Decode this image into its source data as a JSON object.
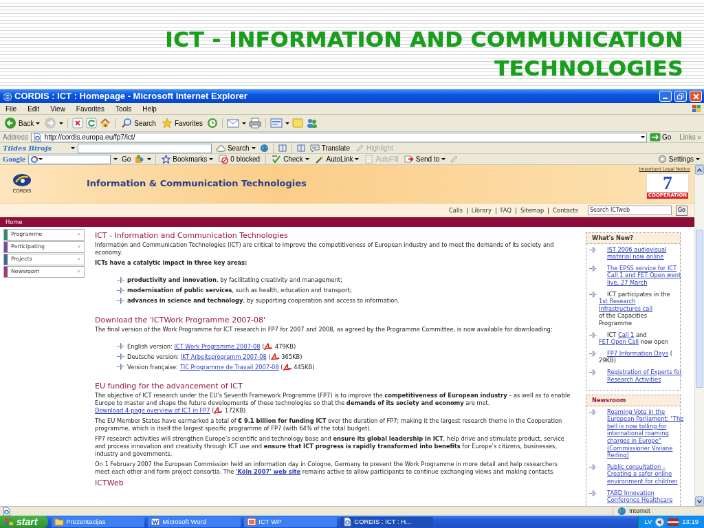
{
  "slide": {
    "title": "ICT - INFORMATION AND COMMUNICATION TECHNOLOGIES"
  },
  "window": {
    "title": "CORDIS : ICT : Homepage - Microsoft Internet Explorer"
  },
  "menu": [
    "File",
    "Edit",
    "View",
    "Favorites",
    "Tools",
    "Help"
  ],
  "toolbar": {
    "back": "Back",
    "search": "Search",
    "favorites": "Favorites"
  },
  "address": {
    "label": "Address",
    "url": "http://cordis.europa.eu/fp7/ict/",
    "go": "Go",
    "links": "Links »"
  },
  "tildes": {
    "logo": "Tildes Birojs",
    "search": "Search",
    "translate": "Translate",
    "highlight": {
      "label": "Highlight",
      "disabled": true
    }
  },
  "google": {
    "logo": "Google",
    "go": "Go",
    "bookmarks": "Bookmarks",
    "blocked": "0 blocked",
    "check": "Check",
    "autolink": "AutoLink",
    "autofill": {
      "label": "AutoFill",
      "disabled": true
    },
    "send_to": "Send to",
    "settings": "Settings"
  },
  "site": {
    "logo_text": "CORDIS",
    "title": "Information & Communication Technologies",
    "legal": "Important Legal Notice",
    "badge_number": "7",
    "badge_text": "COOPERATION",
    "nav": [
      "Calls",
      "Library",
      "FAQ",
      "Sitemap",
      "Contacts"
    ],
    "search_value": "Search ICTweb",
    "search_button": "Go",
    "breadcrumb": "Home"
  },
  "left_nav": [
    {
      "label": "Programme",
      "arrow": "»",
      "color": "#2e8b6e"
    },
    {
      "label": "Participating",
      "arrow": "»",
      "color": "#7a4c9c"
    },
    {
      "label": "Projects",
      "arrow": "»",
      "color": "#3a6a9c"
    },
    {
      "label": "Newsroom",
      "arrow": "»",
      "color": "#9c3a7a"
    }
  ],
  "main": [
    {
      "kind": "heading",
      "text": "ICT - Information and Communication Technologies"
    },
    {
      "kind": "paragraph",
      "parts": [
        {
          "kind": "text",
          "text": "Information and Communication Technologies (ICT) are critical to improve the competitiveness of European industry and to meet the demands of its society and economy."
        }
      ]
    },
    {
      "kind": "lead",
      "parts": [
        {
          "kind": "text",
          "text": "ICTs have a catalytic impact in three key areas:"
        }
      ]
    },
    {
      "kind": "bullets",
      "items": [
        {
          "parts": [
            {
              "kind": "text",
              "text": "**productivity and innovation**, by facilitating creativity and management;"
            }
          ]
        },
        {
          "parts": [
            {
              "kind": "text",
              "text": "**modernisation of public services**, such as health, education and transport;"
            }
          ]
        },
        {
          "parts": [
            {
              "kind": "text",
              "text": "**advances in science and technology**, by supporting cooperation and access to information."
            }
          ]
        }
      ]
    },
    {
      "kind": "heading",
      "text": "Download the 'ICTWork Programme 2007-08'"
    },
    {
      "kind": "paragraph",
      "parts": [
        {
          "kind": "text",
          "text": "The final version of the Work Programme for ICT research in FP7 for 2007 and 2008, as agreed by the Programme Committee, is now available for downloading:"
        }
      ]
    },
    {
      "kind": "bullets",
      "items": [
        {
          "parts": [
            {
              "kind": "text",
              "text": "English version: "
            },
            {
              "kind": "link",
              "text": "ICT Work Programme 2007-08"
            },
            {
              "kind": "text",
              "text": " ("
            },
            {
              "kind": "pdf"
            },
            {
              "kind": "text",
              "text": " 479KB)"
            }
          ]
        },
        {
          "parts": [
            {
              "kind": "text",
              "text": "Deutsche version: "
            },
            {
              "kind": "link",
              "text": "IKT Arbeitsprogramm 2007-08"
            },
            {
              "kind": "text",
              "text": " ("
            },
            {
              "kind": "pdf"
            },
            {
              "kind": "text",
              "text": " 365KB)"
            }
          ]
        },
        {
          "parts": [
            {
              "kind": "text",
              "text": "Version française: "
            },
            {
              "kind": "link",
              "text": "TIC Programme de Travail 2007-08"
            },
            {
              "kind": "text",
              "text": " ("
            },
            {
              "kind": "pdf"
            },
            {
              "kind": "text",
              "text": " 445KB)"
            }
          ]
        }
      ]
    },
    {
      "kind": "heading",
      "text": "EU funding for the advancement of ICT"
    },
    {
      "kind": "paragraph",
      "parts": [
        {
          "kind": "text",
          "text": "The objective of ICT research under the EU’s Seventh Framework Programme (FP7) is to improve the **competitiveness of European industry** – as well as to enable Europe to master and shape the future developments of these technologies so that the **demands of its society and economy** are met. "
        },
        {
          "kind": "link",
          "text": "Download 4-page overview of ICT in FP7"
        },
        {
          "kind": "text",
          "text": " ("
        },
        {
          "kind": "pdf"
        },
        {
          "kind": "text",
          "text": " 172KB)"
        }
      ]
    },
    {
      "kind": "paragraph",
      "parts": [
        {
          "kind": "text",
          "text": "The EU Member States have earmarked a total of **€ 9.1 billion for funding ICT** over the duration of FP7; making it the largest research theme in the Cooperation programme, which is itself the largest specific programme of FP7 (with 64% of the total budget)."
        }
      ]
    },
    {
      "kind": "paragraph",
      "parts": [
        {
          "kind": "text",
          "text": "FP7 research activities will strengthen Europe’s scientific and technology base and **ensure its global leadership in ICT**, help drive and stimulate product, service and process innovation and creativity through ICT use and **ensure that ICT progress is rapidly transformed into benefits** for Europe’s citizens, businesses, industry and governments."
        }
      ]
    },
    {
      "kind": "paragraph",
      "parts": [
        {
          "kind": "text",
          "text": "On 1 February 2007 the European Commission held an information day in Cologne, Germany to present the Work Programme in more detail and help researchers meet each other and form project consortia. The "
        },
        {
          "kind": "link",
          "text": "'Köln 2007' web site",
          "bold": true
        },
        {
          "kind": "text",
          "text": " remains active to allow participants to continue exchanging views and making contacts."
        }
      ]
    },
    {
      "kind": "heading",
      "text": "ICTWeb"
    }
  ],
  "whats_new": {
    "title": "What's New?",
    "items": [
      {
        "parts": [
          {
            "kind": "link",
            "text": "IST 2006 audiovisual material now online"
          }
        ]
      },
      {
        "parts": [
          {
            "kind": "link",
            "text": "The EPSS service for ICT Call 1 and FET Open went live, 27 March"
          }
        ]
      },
      {
        "parts": [
          {
            "kind": "text",
            "text": "ICT participates in the "
          },
          {
            "kind": "link",
            "text": "1st Research Infrastructures call"
          },
          {
            "kind": "text",
            "text": " of the Capacities Programme"
          }
        ]
      },
      {
        "parts": [
          {
            "kind": "text",
            "text": "ICT "
          },
          {
            "kind": "link",
            "text": "Call 1"
          },
          {
            "kind": "text",
            "text": " and "
          },
          {
            "kind": "link",
            "text": "FET Open Call"
          },
          {
            "kind": "text",
            "text": " now open"
          }
        ]
      },
      {
        "parts": [
          {
            "kind": "link",
            "text": "FP7 Information Days"
          },
          {
            "kind": "text",
            "text": " ( 29KB)"
          }
        ]
      },
      {
        "parts": [
          {
            "kind": "link",
            "text": "Registration of Experts for Research Activities"
          }
        ]
      }
    ]
  },
  "newsroom": {
    "title": "Newsroom",
    "items": [
      {
        "parts": [
          {
            "kind": "link",
            "text": "Roaming Vote in the European Parliament: \"The bell is now tolling for international roaming charges in Europe\" (Commissioner Viviane Reding)"
          }
        ]
      },
      {
        "parts": [
          {
            "kind": "link",
            "text": "Public consultation – Creating a safer online environment for children"
          }
        ]
      },
      {
        "parts": [
          {
            "kind": "link",
            "text": "TABD Innovation Conference Healthcare"
          }
        ]
      }
    ]
  },
  "status_bar": {
    "zone": "Internet"
  },
  "taskbar": {
    "start": "start",
    "tasks": [
      {
        "label": "Prezentacijas",
        "selected": false
      },
      {
        "label": "Microsoft Word",
        "selected": false
      },
      {
        "label": "ICT WP",
        "selected": false
      },
      {
        "label": "CORDIS : ICT : H...",
        "selected": true
      }
    ],
    "language": "LV",
    "clock": "13:19"
  }
}
